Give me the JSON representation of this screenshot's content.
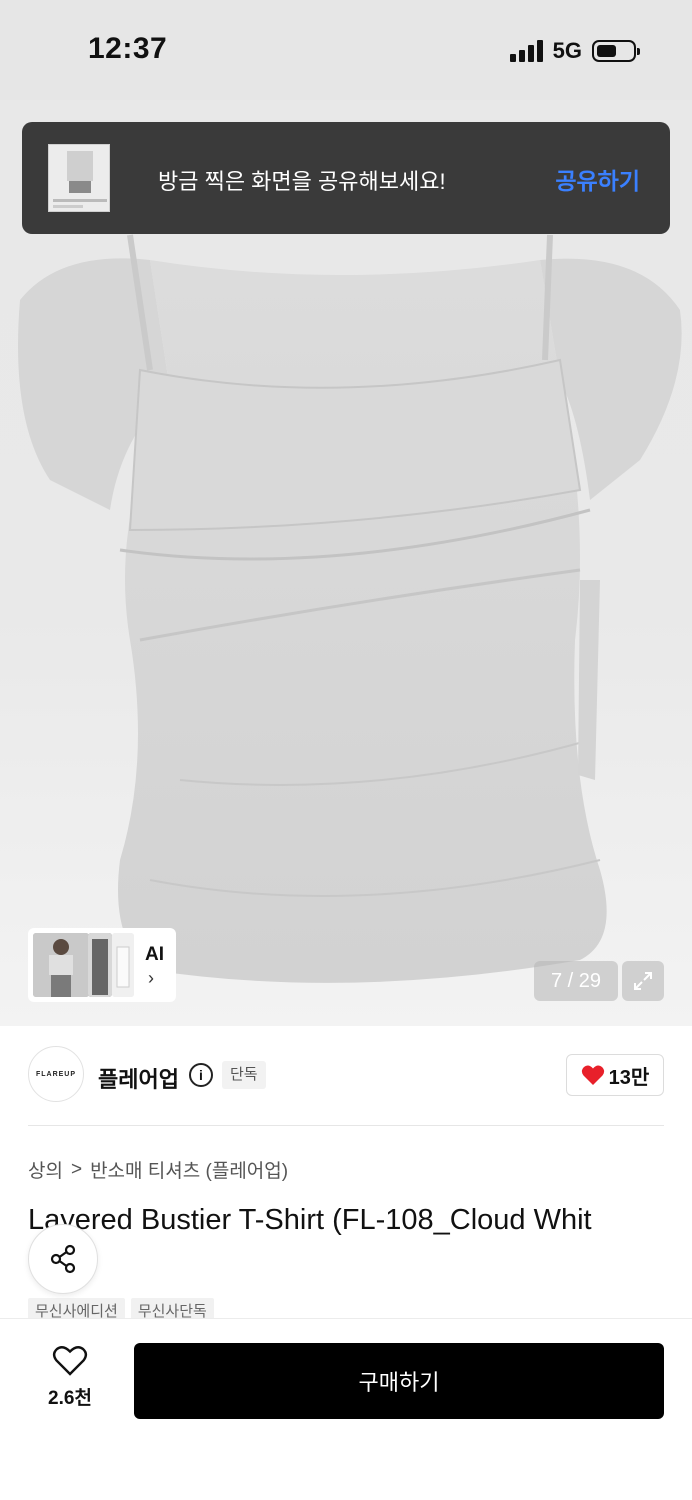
{
  "status_bar": {
    "time": "12:37",
    "network": "5G"
  },
  "toast": {
    "message": "방금 찍은 화면을 공유해보세요!",
    "action": "공유하기"
  },
  "gallery": {
    "ai_label": "AI",
    "ai_arrow": "›",
    "counter": "7 / 29",
    "current_image": 7,
    "total_images": 29
  },
  "brand": {
    "logo_text": "FLAREUP",
    "name": "플레어업",
    "info_glyph": "i",
    "badge": "단독",
    "like_count": "13만",
    "like_color": "#e8202a"
  },
  "breadcrumb": {
    "items": [
      "상의",
      "반소매 티셔츠 (플레어업)"
    ],
    "separator": ">"
  },
  "product": {
    "title": "Layered Bustier T-Shirt (FL-108_Cloud Whit",
    "tags": [
      "무신사에디션",
      "무신사단독"
    ]
  },
  "bottom_bar": {
    "wish_count": "2.6천",
    "buy_label": "구매하기"
  },
  "colors": {
    "accent_blue": "#3a80ff",
    "toast_bg": "#3a3a3a",
    "buy_bg": "#000000"
  }
}
